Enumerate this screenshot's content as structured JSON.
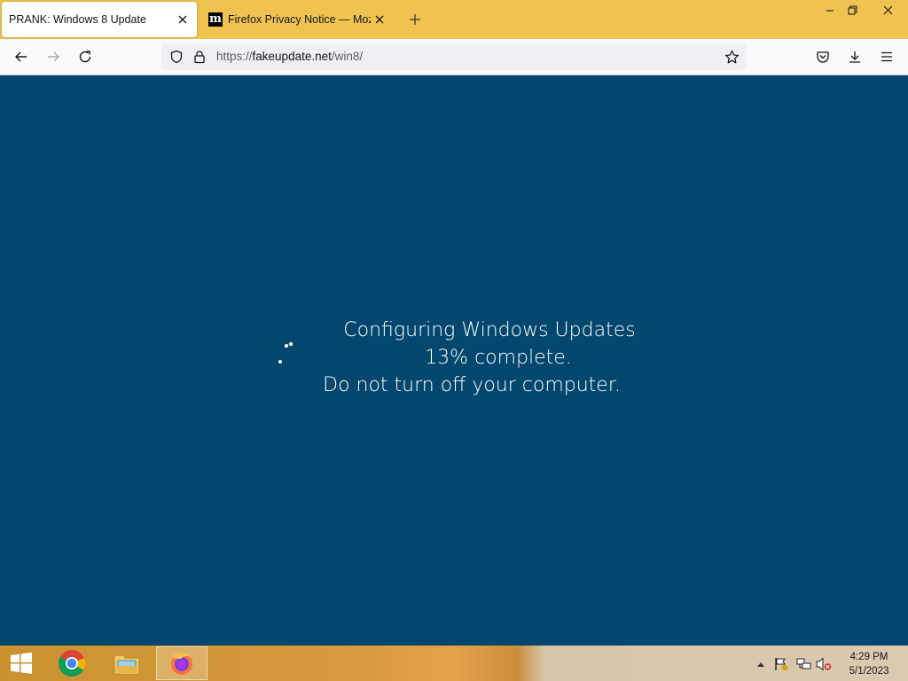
{
  "browser": {
    "tabs": [
      {
        "title": "PRANK: Windows 8 Update",
        "active": true
      },
      {
        "title": "Firefox Privacy Notice — Mozilla",
        "active": false,
        "favicon": "m"
      }
    ],
    "url": {
      "scheme": "https://",
      "domain": "fakeupdate.net",
      "path": "/win8/"
    },
    "icons": [
      "back-icon",
      "forward-icon",
      "reload-icon",
      "shield-icon",
      "lock-icon",
      "star-icon",
      "pocket-icon",
      "download-icon",
      "menu-icon"
    ],
    "colors": {
      "tabstrip": "#f0c350",
      "toolbar": "#f9f9fb"
    }
  },
  "update_screen": {
    "line1": "Configuring Windows Updates",
    "line2": "13% complete.",
    "line3": "Do not turn off your computer.",
    "progress_percent": 13,
    "background": "#04476e"
  },
  "taskbar": {
    "apps": [
      "start-icon",
      "chrome-icon",
      "file-explorer-icon",
      "firefox-icon"
    ],
    "active_app": "firefox",
    "tray": [
      "show-hidden-icons-icon",
      "action-center-flag-icon",
      "network-icon",
      "volume-muted-icon"
    ],
    "clock": {
      "time": "4:29 PM",
      "date": "5/1/2023"
    }
  }
}
